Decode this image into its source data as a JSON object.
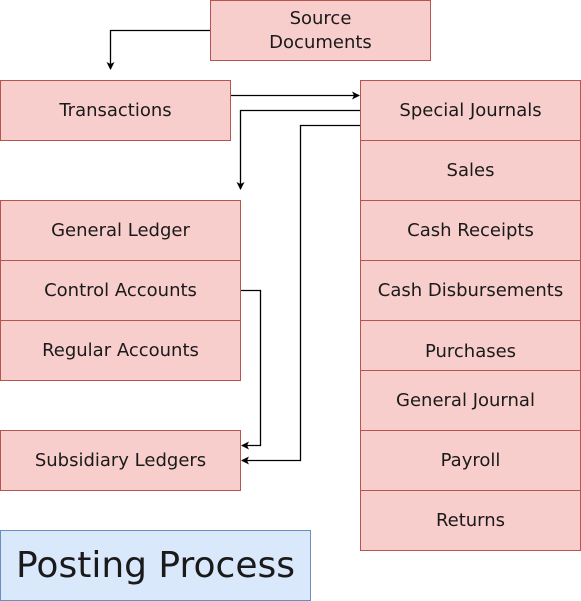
{
  "diagram": {
    "title": "Posting Process",
    "source": "Source Documents",
    "transactions": "Transactions",
    "ledger": {
      "header": "General Ledger",
      "items": [
        "Control Accounts",
        "Regular Accounts"
      ]
    },
    "subsidiary": "Subsidiary Ledgers",
    "journals": {
      "header": "Special Journals",
      "items": [
        "Sales",
        "Cash Receipts",
        "Cash Disbursements",
        "Purchases",
        "General Journal",
        "Payroll",
        "Returns"
      ]
    },
    "colors": {
      "box_fill": "#f8cecc",
      "box_border": "#b85450",
      "title_fill": "#dae8fc",
      "title_border": "#6c8ebf",
      "arrow": "#000000"
    }
  }
}
